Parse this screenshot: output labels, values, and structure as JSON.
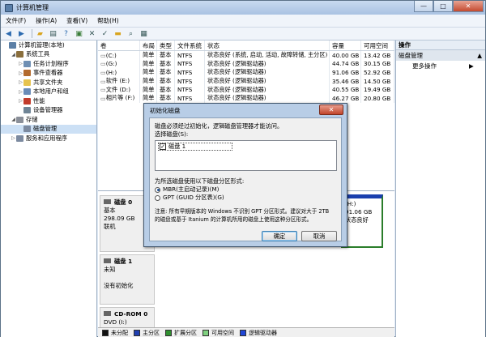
{
  "window": {
    "title": "计算机管理",
    "min": "—",
    "max": "□",
    "close": "✕"
  },
  "menu": [
    "文件(F)",
    "操作(A)",
    "查看(V)",
    "帮助(H)"
  ],
  "toolbar": [
    "back-arrow-icon",
    "forward-arrow-icon",
    "folder-up-icon",
    "properties-icon",
    "help-icon",
    "refresh-icon",
    "delete-icon",
    "check-icon",
    "open-icon",
    "search-icon",
    "view-icon"
  ],
  "tree": [
    {
      "label": "计算机管理(本地)",
      "level": 0,
      "exp": "",
      "color": "#5b7fa6"
    },
    {
      "label": "系统工具",
      "level": 1,
      "exp": "◢",
      "color": "#8a6e3c"
    },
    {
      "label": "任务计划程序",
      "level": 2,
      "exp": "▷",
      "color": "#6f8fb3"
    },
    {
      "label": "事件查看器",
      "level": 2,
      "exp": "▷",
      "color": "#b36a2d"
    },
    {
      "label": "共享文件夹",
      "level": 2,
      "exp": "▷",
      "color": "#e6c34f"
    },
    {
      "label": "本地用户和组",
      "level": 2,
      "exp": "▷",
      "color": "#6a8cb8"
    },
    {
      "label": "性能",
      "level": 2,
      "exp": "▷",
      "color": "#c23b2b"
    },
    {
      "label": "设备管理器",
      "level": 2,
      "exp": "",
      "color": "#6f8496"
    },
    {
      "label": "存储",
      "level": 1,
      "exp": "◢",
      "color": "#8a8f99"
    },
    {
      "label": "磁盘管理",
      "level": 2,
      "exp": "",
      "color": "#7c8aa0",
      "selected": true
    },
    {
      "label": "服务和应用程序",
      "level": 1,
      "exp": "▷",
      "color": "#7c8aa0"
    }
  ],
  "list": {
    "headers": [
      "卷",
      "布局",
      "类型",
      "文件系统",
      "状态",
      "容量",
      "可用空间"
    ],
    "rows": [
      [
        "(C:)",
        "简单",
        "基本",
        "NTFS",
        "状态良好 (系统, 启动, 活动, 故障转储, 主分区)",
        "40.00 GB",
        "13.42 GB"
      ],
      [
        "(G:)",
        "简单",
        "基本",
        "NTFS",
        "状态良好 (逻辑驱动器)",
        "44.74 GB",
        "30.15 GB"
      ],
      [
        "(H:)",
        "简单",
        "基本",
        "NTFS",
        "状态良好 (逻辑驱动器)",
        "91.06 GB",
        "52.92 GB"
      ],
      [
        "软件 (E:)",
        "简单",
        "基本",
        "NTFS",
        "状态良好 (逻辑驱动器)",
        "35.46 GB",
        "14.50 GB"
      ],
      [
        "文件 (D:)",
        "简单",
        "基本",
        "NTFS",
        "状态良好 (逻辑驱动器)",
        "40.55 GB",
        "19.49 GB"
      ],
      [
        "相片等 (F:)",
        "简单",
        "基本",
        "NTFS",
        "状态良好 (逻辑驱动器)",
        "46.27 GB",
        "20.80 GB"
      ]
    ]
  },
  "disks": {
    "d0": {
      "name": "磁盘 0",
      "type": "基本",
      "size": "298.09 GB",
      "state": "联机"
    },
    "d1": {
      "name": "磁盘 1",
      "type": "未知",
      "state": "没有初始化"
    },
    "cd": {
      "name": "CD-ROM 0",
      "type": "DVD (I:)"
    },
    "vol": {
      "name": "(H:)",
      "size": "91.06 GB",
      "state": "状态良好"
    }
  },
  "legend": [
    {
      "label": "未分配",
      "color": "#111111"
    },
    {
      "label": "主分区",
      "color": "#1f3fb0"
    },
    {
      "label": "扩展分区",
      "color": "#2f8f2f"
    },
    {
      "label": "可用空间",
      "color": "#7fd07f"
    },
    {
      "label": "逻辑驱动器",
      "color": "#1f46d6"
    }
  ],
  "actions": {
    "header": "操作",
    "section": "磁盘管理",
    "item": "更多操作"
  },
  "dialog": {
    "title": "初始化磁盘",
    "intro": "磁盘必须经过初始化，逻辑磁盘管理器才能访问。",
    "select_label": "选择磁盘(S):",
    "disk_item": "磁盘 1",
    "partition_label": "为所选磁盘使用以下磁盘分区形式:",
    "mbr": "MBR(主启动记录)(M)",
    "gpt": "GPT (GUID 分区表)(G)",
    "note": "注意: 所有早期版本的 Windows 不识别 GPT 分区形式。建议对大于 2TB 的磁盘或基于 Itanium 的计算机所用的磁盘上使用这种分区形式。",
    "ok": "确定",
    "cancel": "取消"
  }
}
